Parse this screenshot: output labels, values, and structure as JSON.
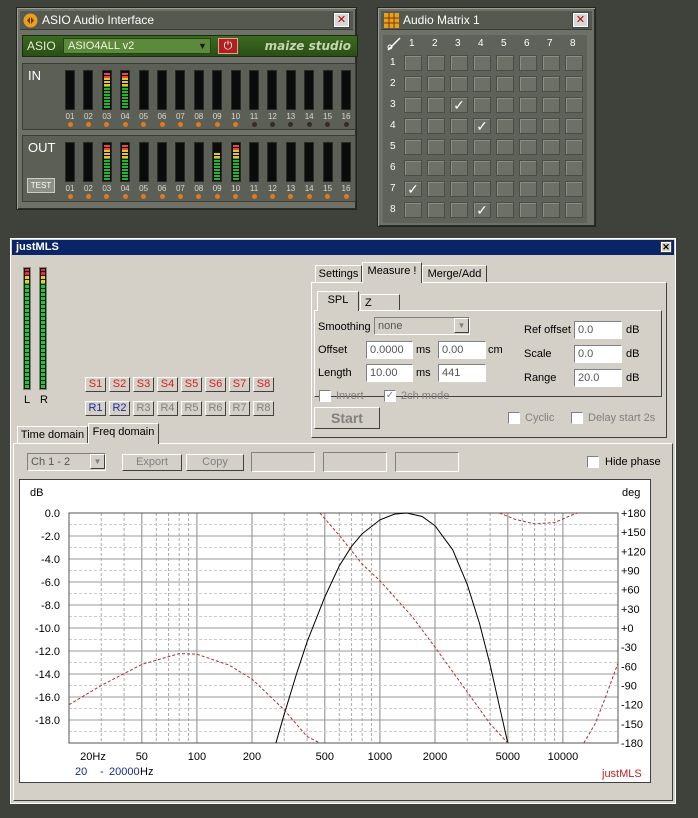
{
  "asio_window": {
    "title": "ASIO Audio Interface",
    "close": "✕",
    "asio_label": "ASIO",
    "driver": "ASIO4ALL v2",
    "brand": "maize studio",
    "in_label": "IN",
    "out_label": "OUT",
    "test_label": "TEST",
    "channels": [
      "01",
      "02",
      "03",
      "04",
      "05",
      "06",
      "07",
      "08",
      "09",
      "10",
      "11",
      "12",
      "13",
      "14",
      "15",
      "16"
    ],
    "in_levels": [
      0,
      0,
      0.95,
      0.95,
      0,
      0,
      0,
      0,
      0,
      0,
      0,
      0,
      0,
      0,
      0,
      0
    ],
    "out_levels": [
      0,
      0,
      0.95,
      0.95,
      0,
      0,
      0,
      0,
      0.7,
      0.95,
      0,
      0,
      0,
      0,
      0,
      0
    ],
    "in_leds": [
      1,
      1,
      1,
      1,
      1,
      1,
      1,
      1,
      1,
      1,
      0,
      0,
      0,
      0,
      0,
      0
    ],
    "out_leds": [
      1,
      1,
      1,
      1,
      1,
      1,
      1,
      1,
      1,
      1,
      1,
      1,
      1,
      1,
      1,
      1
    ]
  },
  "matrix_window": {
    "title": "Audio Matrix 1",
    "close": "✕",
    "cols": [
      "1",
      "2",
      "3",
      "4",
      "5",
      "6",
      "7",
      "8"
    ],
    "rows": [
      "1",
      "2",
      "3",
      "4",
      "5",
      "6",
      "7",
      "8"
    ],
    "checked": [
      [
        3,
        3
      ],
      [
        4,
        4
      ],
      [
        7,
        1
      ],
      [
        8,
        4
      ]
    ],
    "check_glyph": "✓"
  },
  "justmls": {
    "title": "justMLS",
    "close": "✕",
    "meter_l": "L",
    "meter_r": "R",
    "s_buttons": [
      "S1",
      "S2",
      "S3",
      "S4",
      "S5",
      "S6",
      "S7",
      "S8"
    ],
    "r_buttons": [
      "R1",
      "R2",
      "R3",
      "R4",
      "R5",
      "R6",
      "R7",
      "R8"
    ],
    "r_enabled": [
      true,
      true,
      false,
      false,
      false,
      false,
      false,
      false
    ],
    "tabs_top": [
      "Settings",
      "Measure !",
      "Merge/Add"
    ],
    "active_top_tab": "Measure !",
    "subtabs": [
      "SPL",
      "Z"
    ],
    "smoothing_label": "Smoothing",
    "smoothing_value": "none",
    "offset_label": "Offset",
    "offset_ms": "0.0000",
    "ms": "ms",
    "offset_cm": "0.00",
    "cm": "cm",
    "length_label": "Length",
    "length_ms": "10.00",
    "length_samples": "441",
    "invert_label": "Invert",
    "twoch_label": "2ch mode",
    "ref_offset_label": "Ref offset",
    "ref_offset": "0.0",
    "scale_label": "Scale",
    "scale": "0.0",
    "range_label": "Range",
    "range": "20.0",
    "db": "dB",
    "start_label": "Start",
    "cyclic_label": "Cyclic",
    "delay_label": "Delay start 2s",
    "domain_tabs": [
      "Time domain",
      "Freq domain"
    ],
    "channel_select": "Ch 1 - 2",
    "export_label": "Export",
    "copy_label": "Copy",
    "hide_phase_label": "Hide phase",
    "freq_min": "20",
    "freq_dash": "-",
    "freq_max": "20000",
    "freq_unit": "Hz",
    "watermark": "justMLS"
  },
  "chart_data": {
    "type": "line",
    "ylabel_left": "dB",
    "ylabel_right": "deg",
    "x_scale": "log",
    "xlim": [
      20,
      20000
    ],
    "ylim_left": [
      -20,
      0
    ],
    "ylim_right": [
      -180,
      180
    ],
    "x_ticks": [
      "20Hz",
      "50",
      "100",
      "200",
      "500",
      "1000",
      "2000",
      "5000",
      "10000"
    ],
    "x_tick_values": [
      20,
      50,
      100,
      200,
      500,
      1000,
      2000,
      5000,
      10000
    ],
    "y_ticks_left": [
      "0.0",
      "-2.0",
      "-4.0",
      "-6.0",
      "-8.0",
      "-10.0",
      "-12.0",
      "-14.0",
      "-16.0",
      "-18.0"
    ],
    "y_tick_values_left": [
      0,
      -2,
      -4,
      -6,
      -8,
      -10,
      -12,
      -14,
      -16,
      -18
    ],
    "y_ticks_right": [
      "+180",
      "+150",
      "+120",
      "+90",
      "+60",
      "+30",
      "+0",
      "-30",
      "-60",
      "-90",
      "-120",
      "-150",
      "-180"
    ],
    "y_tick_values_right": [
      180,
      150,
      120,
      90,
      60,
      30,
      0,
      -30,
      -60,
      -90,
      -120,
      -150,
      -180
    ],
    "grid": true,
    "series": [
      {
        "color": "#000000",
        "axis": "left",
        "x": [
          270,
          300,
          350,
          400,
          500,
          600,
          700,
          800,
          1000,
          1200,
          1400,
          1700,
          2000,
          2500,
          3000,
          3500,
          4000,
          4500,
          5000
        ],
        "y": [
          -20,
          -17.5,
          -14,
          -11.2,
          -7.3,
          -4.6,
          -2.9,
          -1.8,
          -0.6,
          -0.1,
          0,
          -0.3,
          -1.1,
          -3.2,
          -6.2,
          -9.6,
          -13.2,
          -16.8,
          -20
        ]
      },
      {
        "color": "#b03030",
        "axis": "right",
        "dashed": true,
        "x": [
          20,
          30,
          50,
          80,
          100,
          150,
          200,
          300,
          400,
          470
        ],
        "y": [
          -120,
          -90,
          -57,
          -40,
          -41,
          -58,
          -80,
          -128,
          -170,
          -180
        ]
      },
      {
        "color": "#b03030",
        "axis": "right",
        "dashed": true,
        "x": [
          470,
          600,
          800,
          1000,
          1500,
          2000,
          3000,
          4000,
          5000
        ],
        "y": [
          180,
          145,
          100,
          74,
          18,
          -30,
          -100,
          -150,
          -180
        ]
      },
      {
        "color": "#b03030",
        "axis": "right",
        "dashed": true,
        "x": [
          4500,
          5500,
          7000,
          9000,
          11000,
          12000
        ],
        "y": [
          180,
          170,
          163,
          165,
          176,
          180
        ]
      },
      {
        "color": "#b03030",
        "axis": "right",
        "dashed": true,
        "x": [
          13000,
          15000,
          17000,
          20000
        ],
        "y": [
          -180,
          -150,
          -110,
          -55
        ]
      }
    ]
  }
}
